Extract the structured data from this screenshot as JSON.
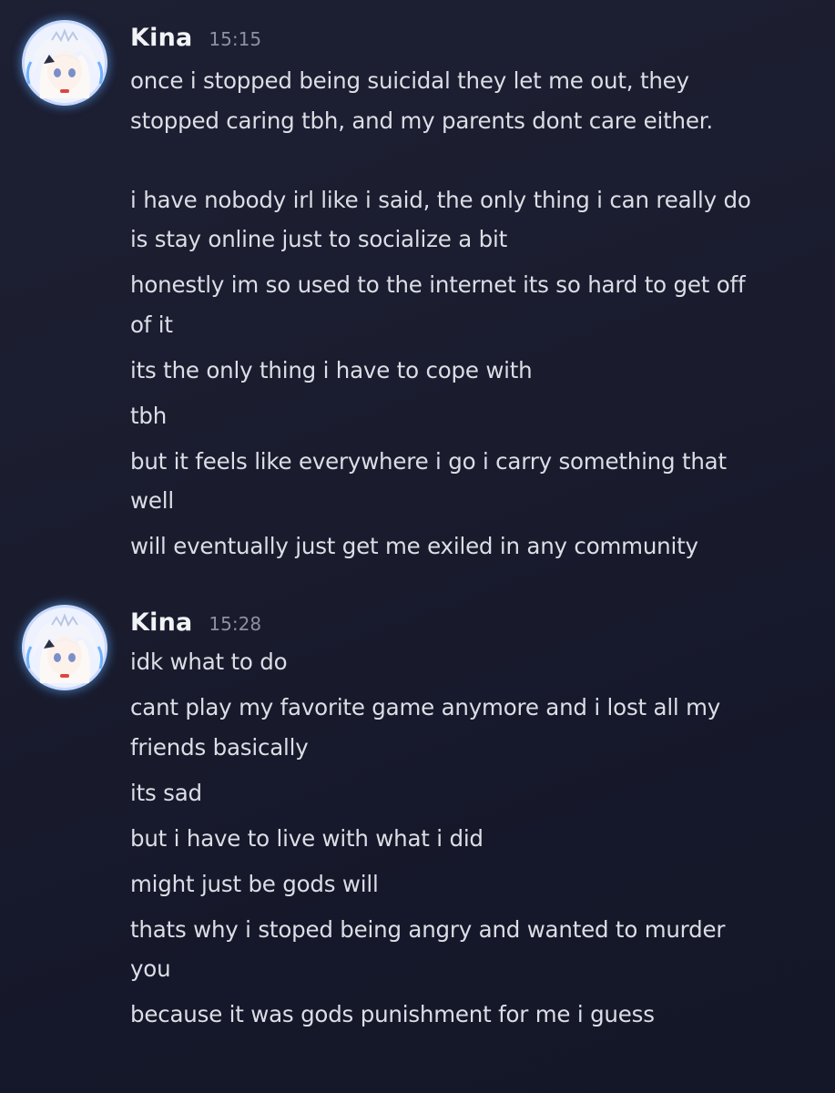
{
  "groups": [
    {
      "author": "Kina",
      "time": "15:15",
      "avatar": "anime-girl-avatar-icon",
      "messages": [
        "once i stopped being suicidal they let me out, they\nstopped caring tbh, and my parents dont care either.\n\ni have nobody irl like i said, the only thing i can really do\nis stay online just to socialize a bit",
        "honestly im so used to the internet its so hard to get off\nof it",
        "its the only thing i have to cope with",
        "tbh",
        "but it feels like everywhere i go i carry something that\nwell",
        "will eventually just get me exiled in any community"
      ]
    },
    {
      "author": "Kina",
      "time": "15:28",
      "avatar": "anime-girl-avatar-icon",
      "messages": [
        "idk what to do",
        "cant play my favorite game anymore and i lost all my\nfriends basically",
        "its sad",
        "but i have to live with what i did",
        "might just be gods will",
        "thats why i stoped being angry and wanted to murder\nyou",
        "because it was gods punishment for me i guess"
      ]
    }
  ],
  "colors": {
    "background": "#1a1c2e",
    "username": "#f2f3f5",
    "timestamp": "#8c90a0",
    "message_text": "#dcdee6",
    "avatar_glow": "#5aaaff"
  }
}
